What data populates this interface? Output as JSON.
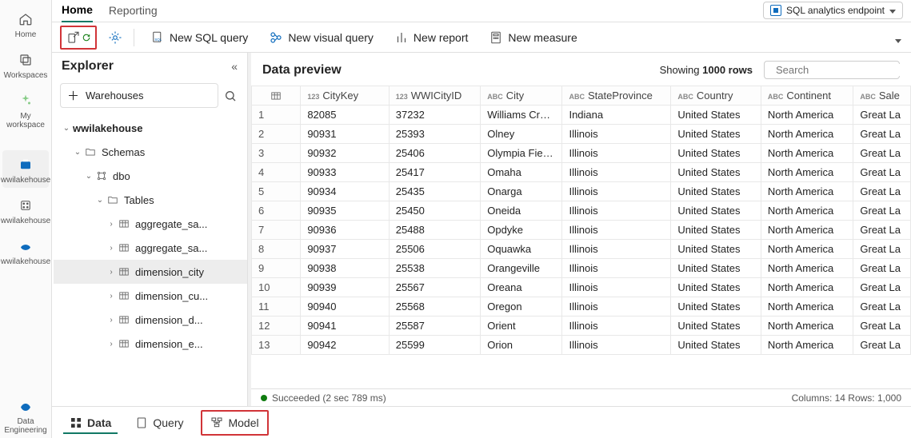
{
  "nav_rail": {
    "items": [
      {
        "label": "Home",
        "name": "nav-home"
      },
      {
        "label": "Workspaces",
        "name": "nav-workspaces"
      },
      {
        "label": "My workspace",
        "name": "nav-my-workspace"
      },
      {
        "label": "wwilakehouse",
        "name": "nav-wwilakehouse-1",
        "selected": true
      },
      {
        "label": "wwilakehouse",
        "name": "nav-wwilakehouse-2"
      },
      {
        "label": "wwilakehouse",
        "name": "nav-wwilakehouse-3"
      }
    ],
    "footer": {
      "label": "Data Engineering"
    }
  },
  "top_tabs": {
    "home": "Home",
    "reporting": "Reporting"
  },
  "endpoint": {
    "label": "SQL analytics endpoint"
  },
  "toolbar": {
    "new_sql": "New SQL query",
    "new_visual": "New visual query",
    "new_report": "New report",
    "new_measure": "New measure"
  },
  "explorer": {
    "title": "Explorer",
    "warehouses_btn": "Warehouses",
    "tree": {
      "root": "wwilakehouse",
      "schemas": "Schemas",
      "dbo": "dbo",
      "tables": "Tables",
      "table_items": [
        "aggregate_sa...",
        "aggregate_sa...",
        "dimension_city",
        "dimension_cu...",
        "dimension_d...",
        "dimension_e..."
      ]
    }
  },
  "preview": {
    "title": "Data preview",
    "showing_prefix": "Showing ",
    "showing_bold": "1000 rows",
    "search_placeholder": "Search",
    "columns": [
      {
        "type": "123",
        "label": "CityKey"
      },
      {
        "type": "123",
        "label": "WWICityID"
      },
      {
        "type": "ABC",
        "label": "City"
      },
      {
        "type": "ABC",
        "label": "StateProvince"
      },
      {
        "type": "ABC",
        "label": "Country"
      },
      {
        "type": "ABC",
        "label": "Continent"
      },
      {
        "type": "ABC",
        "label": "Sale"
      }
    ],
    "rows": [
      [
        "82085",
        "37232",
        "Williams Creek",
        "Indiana",
        "United States",
        "North America",
        "Great La"
      ],
      [
        "90931",
        "25393",
        "Olney",
        "Illinois",
        "United States",
        "North America",
        "Great La"
      ],
      [
        "90932",
        "25406",
        "Olympia Fields",
        "Illinois",
        "United States",
        "North America",
        "Great La"
      ],
      [
        "90933",
        "25417",
        "Omaha",
        "Illinois",
        "United States",
        "North America",
        "Great La"
      ],
      [
        "90934",
        "25435",
        "Onarga",
        "Illinois",
        "United States",
        "North America",
        "Great La"
      ],
      [
        "90935",
        "25450",
        "Oneida",
        "Illinois",
        "United States",
        "North America",
        "Great La"
      ],
      [
        "90936",
        "25488",
        "Opdyke",
        "Illinois",
        "United States",
        "North America",
        "Great La"
      ],
      [
        "90937",
        "25506",
        "Oquawka",
        "Illinois",
        "United States",
        "North America",
        "Great La"
      ],
      [
        "90938",
        "25538",
        "Orangeville",
        "Illinois",
        "United States",
        "North America",
        "Great La"
      ],
      [
        "90939",
        "25567",
        "Oreana",
        "Illinois",
        "United States",
        "North America",
        "Great La"
      ],
      [
        "90940",
        "25568",
        "Oregon",
        "Illinois",
        "United States",
        "North America",
        "Great La"
      ],
      [
        "90941",
        "25587",
        "Orient",
        "Illinois",
        "United States",
        "North America",
        "Great La"
      ],
      [
        "90942",
        "25599",
        "Orion",
        "Illinois",
        "United States",
        "North America",
        "Great La"
      ]
    ],
    "status": "Succeeded (2 sec 789 ms)",
    "footer_cols": "Columns: 14 Rows: 1,000"
  },
  "bottom_tabs": {
    "data": "Data",
    "query": "Query",
    "model": "Model"
  }
}
